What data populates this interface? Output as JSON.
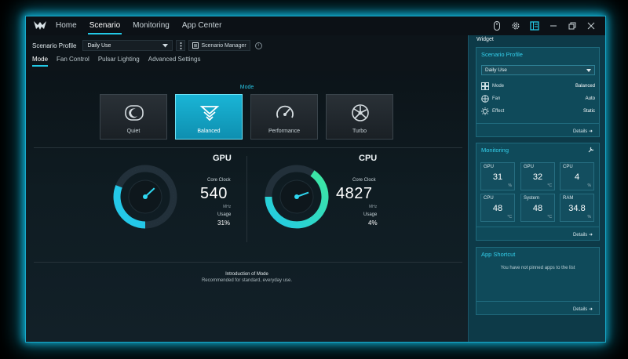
{
  "nav": {
    "items": [
      "Home",
      "Scenario",
      "Monitoring",
      "App Center"
    ],
    "active": "Scenario"
  },
  "profile": {
    "label": "Scenario Profile",
    "selected": "Daily Use",
    "manager_label": "Scenario Manager",
    "info": "i"
  },
  "subtabs": {
    "items": [
      "Mode",
      "Fan Control",
      "Pulsar Lighting",
      "Advanced Settings"
    ],
    "active": "Mode"
  },
  "mode": {
    "title": "Mode",
    "options": [
      "Quiet",
      "Balanced",
      "Performance",
      "Turbo"
    ],
    "selected": "Balanced"
  },
  "gpu": {
    "title": "GPU",
    "clock_label": "Core Clock",
    "clock_value": "540",
    "clock_unit": "MHz",
    "usage_label": "Usage",
    "usage_value": "31%",
    "usage_fraction": 0.31
  },
  "cpu": {
    "title": "CPU",
    "clock_label": "Core Clock",
    "clock_value": "4827",
    "clock_unit": "MHz",
    "usage_label": "Usage",
    "usage_value": "4%",
    "usage_fraction": 0.04
  },
  "intro": {
    "title": "Introduction of Mode",
    "description": "Recommended for standard, everyday use."
  },
  "widget": {
    "title": "Widget",
    "scenario": {
      "title": "Scenario Profile",
      "selected": "Daily Use",
      "rows": [
        {
          "label": "Mode",
          "value": "Balanced"
        },
        {
          "label": "Fan",
          "value": "Auto"
        },
        {
          "label": "Effect",
          "value": "Static"
        }
      ],
      "details": "Details"
    },
    "monitoring": {
      "title": "Monitoring",
      "tiles": [
        {
          "name": "GPU",
          "value": "31",
          "unit": "%"
        },
        {
          "name": "GPU",
          "value": "32",
          "unit": "°C"
        },
        {
          "name": "CPU",
          "value": "4",
          "unit": "%"
        },
        {
          "name": "CPU",
          "value": "48",
          "unit": "°C"
        },
        {
          "name": "System",
          "value": "48",
          "unit": "°C"
        },
        {
          "name": "RAM",
          "value": "34.8",
          "unit": "%"
        }
      ],
      "details": "Details"
    },
    "shortcut": {
      "title": "App Shortcut",
      "empty": "You have not pinned apps to the list",
      "details": "Details"
    }
  },
  "colors": {
    "accent": "#22c9e6",
    "panel": "#0d3a48",
    "gauge_green": "#3ee8a0"
  }
}
